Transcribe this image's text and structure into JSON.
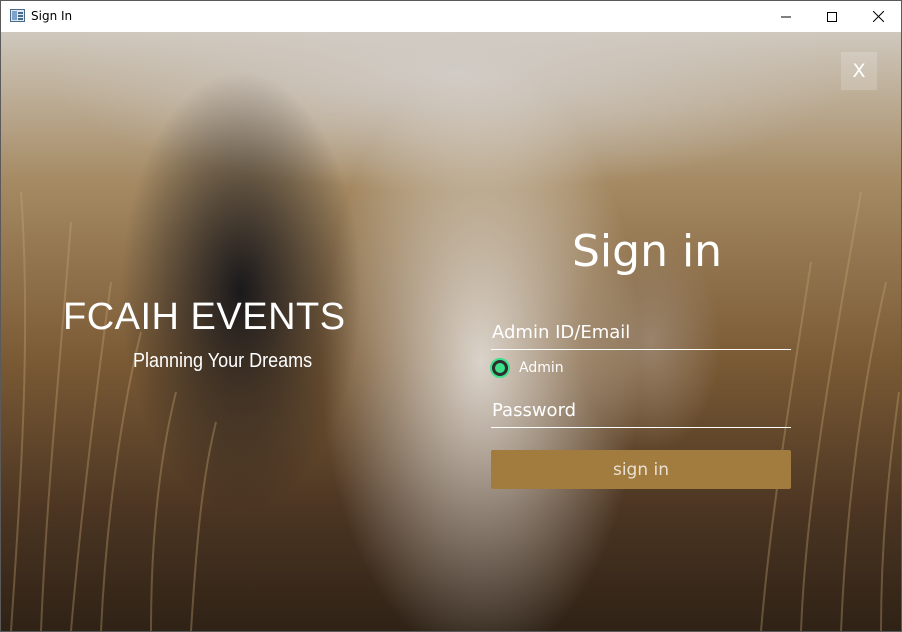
{
  "window": {
    "title": "Sign In",
    "minimize_icon": "minimize-icon",
    "maximize_icon": "maximize-icon",
    "close_icon": "close-icon"
  },
  "overlay_close": {
    "label": "X"
  },
  "brand": {
    "name": "FCAIH EVENTS",
    "tagline": "Planning Your Dreams"
  },
  "form": {
    "title": "Sign in",
    "id_placeholder": "Admin ID/Email",
    "role_option": {
      "label": "Admin",
      "selected": true
    },
    "password_placeholder": "Password",
    "submit_label": "sign in"
  },
  "colors": {
    "accent_button": "#a27b3f",
    "radio_accent": "#3fe08a",
    "text": "#ffffff"
  }
}
